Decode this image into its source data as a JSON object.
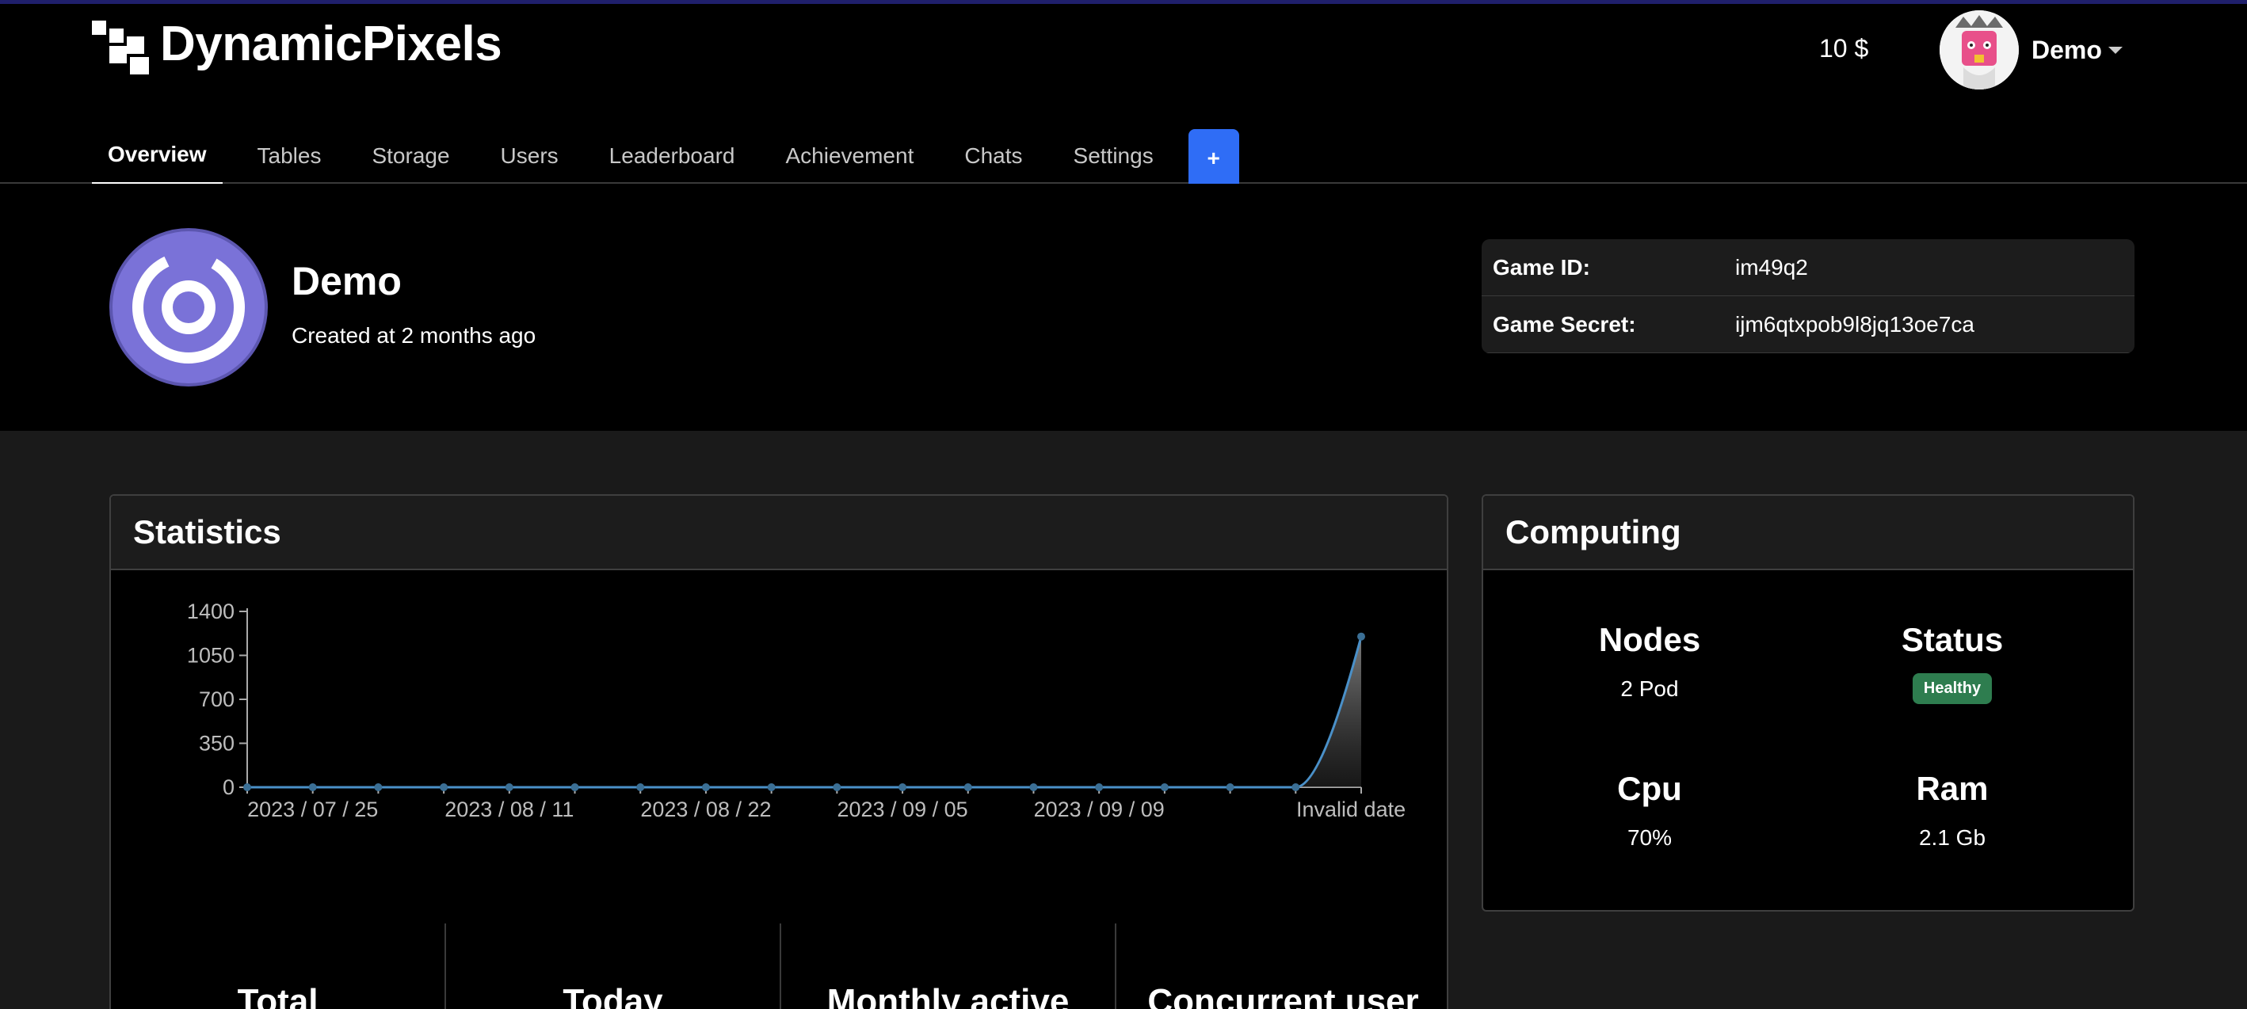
{
  "brand": {
    "name_bold": "Dynamic",
    "name_rest": "Pixels"
  },
  "account": {
    "balance": "10 $",
    "user": "Demo"
  },
  "tabs": [
    {
      "label": "Overview",
      "active": true
    },
    {
      "label": "Tables"
    },
    {
      "label": "Storage"
    },
    {
      "label": "Users"
    },
    {
      "label": "Leaderboard"
    },
    {
      "label": "Achievement"
    },
    {
      "label": "Chats"
    },
    {
      "label": "Settings"
    }
  ],
  "tab_add_label": "+",
  "game": {
    "title": "Demo",
    "created": "Created at 2 months ago",
    "id_label": "Game ID:",
    "id": "im49q2",
    "secret_label": "Game Secret:",
    "secret": "ijm6qtxpob9l8jq13oe7ca"
  },
  "statistics": {
    "title": "Statistics",
    "totals": [
      "Total",
      "Today",
      "Monthly active",
      "Concurrent user"
    ]
  },
  "chart_data": {
    "type": "area",
    "x_tick_labels": [
      "2023 / 07 / 25",
      "2023 / 08 / 11",
      "2023 / 08 / 22",
      "2023 / 09 / 05",
      "2023 / 09 / 09",
      "Invalid date"
    ],
    "y_ticks": [
      0,
      350,
      700,
      1050,
      1400
    ],
    "ylim": [
      0,
      1400
    ],
    "values": [
      0,
      0,
      0,
      0,
      0,
      0,
      0,
      0,
      0,
      0,
      0,
      0,
      0,
      0,
      0,
      0,
      0,
      1200
    ],
    "line_color": "#4a90c8",
    "grid": false
  },
  "computing": {
    "title": "Computing",
    "nodes_label": "Nodes",
    "nodes_value": "2 Pod",
    "status_label": "Status",
    "status_value": "Healthy",
    "cpu_label": "Cpu",
    "cpu_value": "70%",
    "ram_label": "Ram",
    "ram_value": "2.1 Gb"
  },
  "colors": {
    "accent": "#2f6df6",
    "healthy": "#2e7d4f",
    "game_logo": "#7a72d8"
  }
}
